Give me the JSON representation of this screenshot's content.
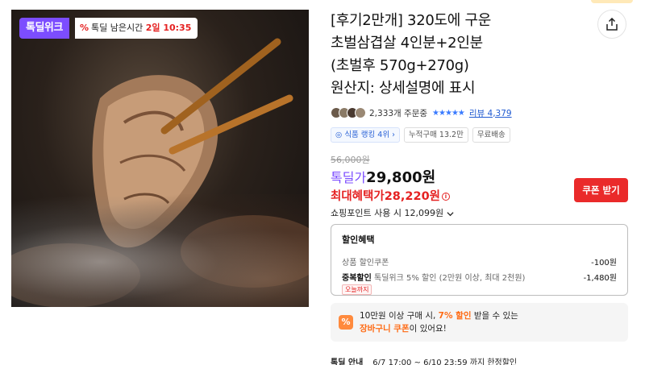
{
  "badges": {
    "week": "톡딜위크",
    "time_label": "톡딜 남은시간",
    "time_value": "2일 10:35"
  },
  "product": {
    "title_lines": [
      "[후기2만개] 320도에 구운",
      "초벌삼겹살 4인분+2인분",
      "(초벌후 570g+270g)",
      "원산지: 상세설명에 표시"
    ]
  },
  "reviews": {
    "order_count": "2,333개 주문중",
    "stars": "★★★★★",
    "review_link": "리뷰 4,379"
  },
  "chips": [
    "식품 랭킹 4위",
    "누적구매 13.2만",
    "무료배송"
  ],
  "price": {
    "original": "56,000원",
    "deal_label": "톡딜가",
    "deal_value": "29,800원",
    "max_label": "최대혜택가",
    "max_value": "28,220원",
    "info_icon": "i",
    "coupon_button": "쿠폰 받기",
    "points": "쇼핑포인트 사용 시 12,099원"
  },
  "discount": {
    "header": "할인혜택",
    "rows": [
      {
        "label": "상품 할인쿠폰",
        "amount": "-100원"
      },
      {
        "label_bold": "중복할인",
        "label": "톡딜위크 5% 할인 (2만원 이상, 최대 2천원)",
        "amount": "-1,480원",
        "tag": "오늘까지"
      }
    ]
  },
  "banner": {
    "icon": "%",
    "line1_a": "10만원 이상 구매 시, ",
    "line1_hl": "7% 할인",
    "line1_b": " 받을 수 있는",
    "line2_hl": "장바구니 쿠폰",
    "line2_b": "이 있어요!"
  },
  "footer": {
    "label": "톡딜 안내",
    "text": "6/7 17:00 ~ 6/10 23:59 까지 한정할인"
  },
  "colors": {
    "brand_purple": "#7c4dff",
    "sale_red": "#e52222",
    "coupon_red": "#ea2a2a",
    "link_blue": "#1f5ad1",
    "banner_orange": "#ff6a13"
  }
}
